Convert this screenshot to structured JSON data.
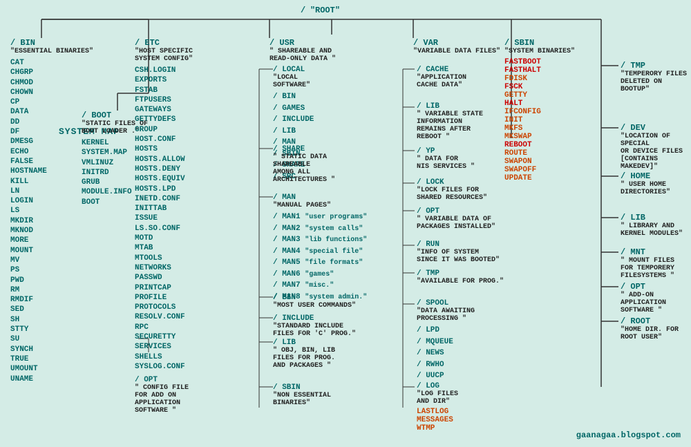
{
  "title": "SYSTEM MAP",
  "watermark": "gaanagaa.blogspot.com",
  "root": {
    "label": "/",
    "name": "\"ROOT\""
  },
  "columns": {
    "bin": {
      "label": "/ BIN",
      "desc": "\"ESSENTIAL BINARIES\"",
      "files": [
        "CAT",
        "CHGRP",
        "CHMOD",
        "CHOWN",
        "CP",
        "DATA",
        "DD",
        "DF",
        "DMESG",
        "ECHO",
        "FALSE",
        "HOSTNAME",
        "KILL",
        "LN",
        "LOGIN",
        "LS",
        "MKDIR",
        "MKNOD",
        "MORE",
        "MOUNT",
        "MV",
        "PS",
        "PWD",
        "RM",
        "RMDIF",
        "SED",
        "SH",
        "STTY",
        "SU",
        "SYNCH",
        "TRUE",
        "UMOUNT",
        "UNAME"
      ]
    },
    "etc": {
      "label": "/ ETC",
      "desc": "\"HOST SPECIFIC SYSTEM CONFIG\"",
      "files": [
        "CSH.LOGIN",
        "EXPORTS",
        "FSTAB",
        "FTPUSERS",
        "GATEWAYS",
        "GETTYDEFS",
        "GROUP",
        "HOST.CONF",
        "HOSTS",
        "HOSTS.ALLOW",
        "HOSTS.DENY",
        "HOSTS.EQUIV",
        "HOSTS.LPD",
        "INETD.CONF",
        "INITTAB",
        "ISSUE",
        "LS.SO.CONF",
        "MOTD",
        "MTAB",
        "MTOOLS",
        "NETWORKS",
        "PASSWD",
        "PRINTCAP",
        "PROFILE",
        "PROTOCOLS",
        "RESOLV.CONF",
        "RPC",
        "SECURETTY",
        "SERVICES",
        "SHELLS",
        "SYSLOG.CONF"
      ],
      "opt": {
        "label": "/ OPT",
        "desc": "\" CONFIG FILE\nFOR ADD ON\nAPPLICATION\nSOFTWARE \""
      }
    },
    "boot": {
      "label": "/ BOOT",
      "desc": "\"STATIC FILES OF\nBOOT LOADER .\"",
      "files": [
        "KERNEL",
        "SYSTEM.MAP",
        "VMLINUZ",
        "INITRD",
        "GRUB",
        "MODULE.INFO",
        "BOOT"
      ]
    },
    "usr": {
      "label": "/ USR",
      "desc": "\" SHAREABLE AND\nREAD-ONLY DATA \"",
      "local": {
        "label": "/ LOCAL",
        "desc": "\"LOCAL\nSOFTWARE\"",
        "subdirs": [
          "/ BIN",
          "/ GAMES",
          "/ INCLUDE",
          "/ LIB",
          "/ MAN",
          "/ SBIN",
          "/ SHARE",
          "/ SRC"
        ]
      },
      "share": {
        "label": "/ SHARE",
        "desc": "\" STATIC DATA\nSHAREABLE\nAMONG ALL\nARCHITECTURES \""
      },
      "man": {
        "label": "/ MAN",
        "desc": "\"MANUAL PAGES\"",
        "subdirs": [
          {
            "label": "/ MAN1",
            "desc": "\"user programs\""
          },
          {
            "label": "/ MAN2",
            "desc": "\"system calls\""
          },
          {
            "label": "/ MAN3",
            "desc": "\"lib functions\""
          },
          {
            "label": "/ MAN4",
            "desc": "\"special file\""
          },
          {
            "label": "/ MAN5",
            "desc": "\"file formats\""
          },
          {
            "label": "/ MAN6",
            "desc": "\"games\""
          },
          {
            "label": "/ MAN7",
            "desc": "\"misc.\""
          },
          {
            "label": "/ MAN8",
            "desc": "\"system admin.\""
          }
        ]
      },
      "bin": {
        "label": "/ BIN",
        "desc": "\"MOST USER COMMANDS\""
      },
      "include": {
        "label": "/ INCLUDE",
        "desc": "\"STANDARD INCLUDE\nFILES FOR 'C' PROG.\""
      },
      "lib": {
        "label": "/ LIB",
        "desc": "\" OBJ, BIN, LIB\nFILES FOR PROG.\nAND PACKAGES \""
      },
      "sbin": {
        "label": "/ SBIN",
        "desc": "\"NON ESSENTIAL\nBINARIES\""
      }
    },
    "var": {
      "label": "/ VAR",
      "desc": "\"VARIABLE DATA FILES\"",
      "cache": {
        "label": "/ CACHE",
        "desc": "\"APPLICATION\nCACHE DATA\""
      },
      "lib": {
        "label": "/ LIB",
        "desc": "\" VARIABLE STATE\nINFORMATION\nREMAINS AFTER\nREBOOT \""
      },
      "yp": {
        "label": "/ YP",
        "desc": "\" DATA FOR\nNIS SERVICES \""
      },
      "lock": {
        "label": "/ LOCK",
        "desc": "\"LOCK FILES FOR\nSHARED RESOURCES\""
      },
      "opt": {
        "label": "/ OPT",
        "desc": "\" VARIABLE DATA OF\nPACKAGES INSTALLED\""
      },
      "run": {
        "label": "/ RUN",
        "desc": "\"INFO OF SYSTEM\nSINCE IT WAS BOOTED\""
      },
      "tmp": {
        "label": "/ TMP",
        "desc": "\"AVAILABLE FOR PROG.\""
      },
      "spool": {
        "label": "/ SPOOL",
        "desc": "\"DATA AWAITING\nPROCESSING \"",
        "subdirs": [
          "/ LPD",
          "/ MQUEUE",
          "/ NEWS",
          "/ RWHO",
          "/ UUCP"
        ]
      },
      "log": {
        "label": "/ LOG",
        "desc": "\"LOG FILES\nAND DIR\"",
        "highlight_files": [
          "LASTLOG",
          "MESSAGES",
          "WTMP"
        ]
      }
    },
    "sbin": {
      "label": "/ SBIN",
      "desc": "\"SYSTEM BINARIES\"",
      "highlight_files": [
        "FASTBOOT",
        "FASTHALT",
        "FDISK",
        "FSCK",
        "GETTY",
        "HALT",
        "IFCONFIG",
        "INIT",
        "MKFS",
        "MKSWAP",
        "REBOOT",
        "ROUTE",
        "SWAPON",
        "SWAPOFF",
        "UPDATE"
      ]
    },
    "tmp": {
      "label": "/ TMP",
      "desc": "\"TEMPERORY FILES\nDELETED ON BOOTUP\""
    },
    "dev": {
      "label": "/ DEV",
      "desc": "\"LOCATION OF SPECIAL\nOR DEVICE FILES\n[CONTAINS MAKEDEV]\""
    },
    "home": {
      "label": "/ HOME",
      "desc": "\" USER HOME\nDIRECTORIES\""
    },
    "lib": {
      "label": "/ LIB",
      "desc": "\"  LIBRARY AND\nKERNEL MODULES\""
    },
    "mnt": {
      "label": "/ MNT",
      "desc": "\"  MOUNT FILES\nFOR TEMPORERY\nFILESYSTEMS \""
    },
    "opt": {
      "label": "/ OPT",
      "desc": "\" ADD-ON APPLICATION\nSOFTWARE \""
    },
    "root": {
      "label": "/ ROOT",
      "desc": "\"HOME DIR. FOR\nROOT USER\""
    }
  }
}
